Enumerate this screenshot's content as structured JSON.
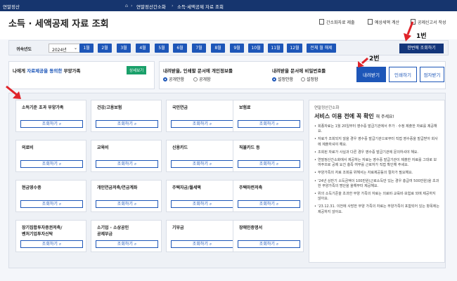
{
  "topbar": {
    "logo": "연말정산",
    "crumb1": "연말정산간소화",
    "crumb2": "소득·세액공제 자료 조회"
  },
  "header": {
    "title": "소득 · 세액공제 자료 조회",
    "links": [
      "간소화자료 제출",
      "예상세액 계산",
      "공제신고서 작성"
    ]
  },
  "yearbar": {
    "label": "귀속년도",
    "year": "2024년",
    "months": [
      "1월",
      "2월",
      "3월",
      "4월",
      "5월",
      "6월",
      "7월",
      "8월",
      "9월",
      "10월",
      "11월",
      "12월"
    ],
    "all_cancel": "전체 월 해제",
    "query_all": "한번에 조회하기"
  },
  "consent": {
    "text_prefix": "나에게 ",
    "text_highlight": "자료제공을 동의한",
    "text_suffix": " 부양가족",
    "detail": "상세보기"
  },
  "personal_info": {
    "title": "내려받을, 인쇄할 문서에 개인정보를",
    "opt1": "공개안함",
    "opt2": "공개함"
  },
  "password": {
    "title": "내려받을 문서에 비밀번호를",
    "opt1": "설정안함",
    "opt2": "설정함"
  },
  "actions": {
    "download": "내려받기",
    "print": "인쇄하기",
    "epost": "점자받기"
  },
  "cards": [
    {
      "title": "소득기준 초과 부양가족"
    },
    {
      "title": "건강/고용보험"
    },
    {
      "title": "국민연금"
    },
    {
      "title": "보험료"
    },
    {
      "title": "의료비"
    },
    {
      "title": "교육비"
    },
    {
      "title": "신용카드"
    },
    {
      "title": "직불카드 등"
    },
    {
      "title": "현금영수증"
    },
    {
      "title": "개인연금저축/연금계좌"
    },
    {
      "title": "주택자금/월세액"
    },
    {
      "title": "주택마련저축"
    },
    {
      "title": "장기집합투자증권저축/\n벤처기업투자신탁"
    },
    {
      "title": "소기업 · 소상공인\n공제부금"
    },
    {
      "title": "기부금"
    },
    {
      "title": "장애인증명서"
    }
  ],
  "card_button": "조회하기",
  "info": {
    "small": "연말정산간소화",
    "headline1": "서비스 이용 전에 꼭 확인",
    "headline2": "해 주세요!",
    "items": [
      "회종자료는 1월 20일부터 영수증 발급기관에서 추가 · 수정 제출한 자료를 제공해요.",
      "자료가 조회되지 않을 경우 영수증 발급기관으로부터 직접 영수증을 발급받아 회사에 제출하셔야 해요.",
      "조회된 자료가 사실과 다른 경우 영수증 발급기관에 문의하셔야 해요.",
      "연말정산간소화에서 제공하는 자료는 영수증 발급기관이 제출한 자료를 그대로 보여주므로 공제 요건 충족 여부를 근로자가 직접 확인해 주세요.",
      "부양가족의 자료 조회를 위해서는 자료제공동의 절차가 필요해요.",
      "'24년 상반기 소득금액이 100만원(근로소득만 있는 경우 총급여 500만원)을 초과한 부양가족의 명단을 올해부터 제공해요.",
      "위의 소득기준을 초과한 부양 가족의 자료는 의료비·교육비·보험료 외에 제공하지 않아요.",
      "'23.12.31. 이전에 사망한 부양 가족의 자료는 부양가족이 포함되어 있는 항목에는 제공하지 않아요."
    ]
  },
  "annotations": {
    "a1": "1번",
    "a2": "2번"
  }
}
